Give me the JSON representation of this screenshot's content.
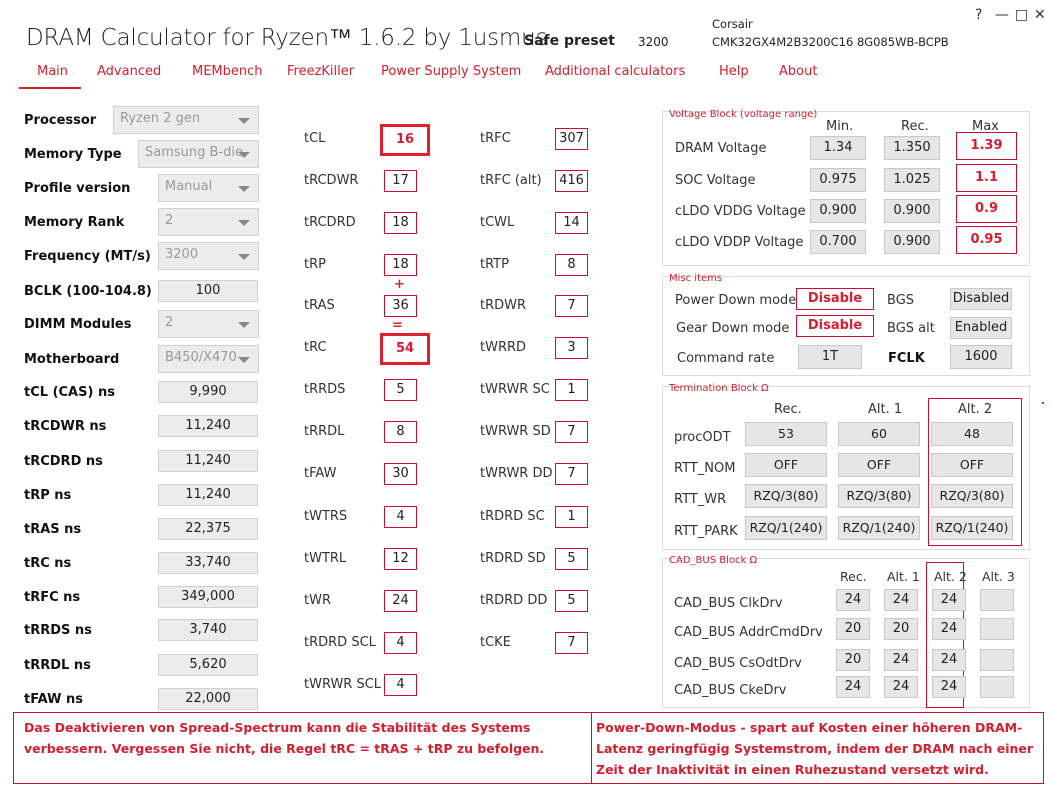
{
  "app": {
    "title": "DRAM Calculator for Ryzen™ 1.6.2 by 1usmus",
    "preset_label": "Safe preset",
    "preset_freq": "3200",
    "mem_vendor": "Corsair",
    "mem_part": "CMK32GX4M2B3200C16 8G085WB-BCPB",
    "window_controls": [
      "?",
      "—",
      "□",
      "✕"
    ]
  },
  "nav": [
    "Main",
    "Advanced",
    "MEMbench",
    "FreezKiller",
    "Power Supply System",
    "Additional calculators",
    "Help",
    "About"
  ],
  "left": {
    "labels": [
      "Processor",
      "Memory Type",
      "Profile version",
      "Memory Rank",
      "Frequency (MT/s)",
      "BCLK (100-104.8)",
      "DIMM Modules",
      "Motherboard",
      "tCL (CAS) ns",
      "tRCDWR ns",
      "tRCDRD ns",
      "tRP ns",
      "tRAS ns",
      "tRC ns",
      "tRFC ns",
      "tRRDS ns",
      "tRRDL ns",
      "tFAW ns"
    ],
    "values": [
      "Ryzen 2 gen",
      "Samsung B-die",
      "Manual",
      "2",
      "3200",
      "100",
      "2",
      "B450/X470",
      "9,990",
      "11,240",
      "11,240",
      "11,240",
      "22,375",
      "33,740",
      "349,000",
      "3,740",
      "5,620",
      "22,000"
    ]
  },
  "timings_col1": {
    "labels": [
      "tCL",
      "tRCDWR",
      "tRCDRD",
      "tRP",
      "tRAS",
      "tRC",
      "tRRDS",
      "tRRDL",
      "tFAW",
      "tWTRS",
      "tWTRL",
      "tWR",
      "tRDRD SCL",
      "tWRWR SCL"
    ],
    "values": [
      "16",
      "17",
      "18",
      "18",
      "36",
      "54",
      "5",
      "8",
      "30",
      "4",
      "12",
      "24",
      "4",
      "4"
    ]
  },
  "timings_col2": {
    "labels": [
      "tRFC",
      "tRFC (alt)",
      "tCWL",
      "tRTP",
      "tRDWR",
      "tWRRD",
      "tWRWR SC",
      "tWRWR SD",
      "tWRWR DD",
      "tRDRD SC",
      "tRDRD SD",
      "tRDRD DD",
      "tCKE"
    ],
    "values": [
      "307",
      "416",
      "14",
      "8",
      "7",
      "3",
      "1",
      "7",
      "7",
      "1",
      "5",
      "5",
      "7"
    ]
  },
  "annotations": {
    "plus": "+",
    "equals": "="
  },
  "voltage": {
    "title": "Voltage Block (voltage range)",
    "headers": [
      "Min.",
      "Rec.",
      "Max"
    ],
    "rows": [
      {
        "label": "DRAM Voltage",
        "min": "1.34",
        "rec": "1.350",
        "max": "1.39"
      },
      {
        "label": "SOC Voltage",
        "min": "0.975",
        "rec": "1.025",
        "max": "1.1"
      },
      {
        "label": "cLDO VDDG Voltage",
        "min": "0.900",
        "rec": "0.900",
        "max": "0.9"
      },
      {
        "label": "cLDO VDDP Voltage",
        "min": "0.700",
        "rec": "0.900",
        "max": "0.95"
      }
    ]
  },
  "misc": {
    "title": "Misc items",
    "power_down_label": "Power Down mode",
    "power_down_value": "Disable",
    "gear_down_label": "Gear Down mode",
    "gear_down_value": "Disable",
    "command_rate_label": "Command rate",
    "command_rate_value": "1T",
    "bgs_label": "BGS",
    "bgs_value": "Disabled",
    "bgs_alt_label": "BGS alt",
    "bgs_alt_value": "Enabled",
    "fclk_label": "FCLK",
    "fclk_value": "1600"
  },
  "termination": {
    "title": "Termination Block Ω",
    "headers": [
      "Rec.",
      "Alt. 1",
      "Alt. 2"
    ],
    "rows": [
      {
        "label": "procODT",
        "vals": [
          "53",
          "60",
          "48"
        ]
      },
      {
        "label": "RTT_NOM",
        "vals": [
          "OFF",
          "OFF",
          "OFF"
        ]
      },
      {
        "label": "RTT_WR",
        "vals": [
          "RZQ/3(80)",
          "RZQ/3(80)",
          "RZQ/3(80)"
        ]
      },
      {
        "label": "RTT_PARK",
        "vals": [
          "RZQ/1(240)",
          "RZQ/1(240)",
          "RZQ/1(240)"
        ]
      }
    ]
  },
  "cadbus": {
    "title": "CAD_BUS Block Ω",
    "headers": [
      "Rec.",
      "Alt. 1",
      "Alt. 2",
      "Alt. 3"
    ],
    "rows": [
      {
        "label": "CAD_BUS ClkDrv",
        "vals": [
          "24",
          "24",
          "24",
          ""
        ]
      },
      {
        "label": "CAD_BUS AddrCmdDrv",
        "vals": [
          "20",
          "20",
          "24",
          ""
        ]
      },
      {
        "label": "CAD_BUS CsOdtDrv",
        "vals": [
          "20",
          "24",
          "24",
          ""
        ]
      },
      {
        "label": "CAD_BUS CkeDrv",
        "vals": [
          "24",
          "24",
          "24",
          ""
        ]
      }
    ]
  },
  "notes": {
    "left": "Das Deaktivieren von Spread-Spectrum kann die Stabilität des Systems verbessern. Vergessen Sie nicht, die Regel tRC = tRAS + tRP zu befolgen.",
    "right": "Power-Down-Modus - spart auf Kosten einer höheren DRAM-Latenz geringfügig Systemstrom, indem der DRAM nach einer Zeit der Inaktivität in einen Ruhezustand versetzt wird."
  }
}
